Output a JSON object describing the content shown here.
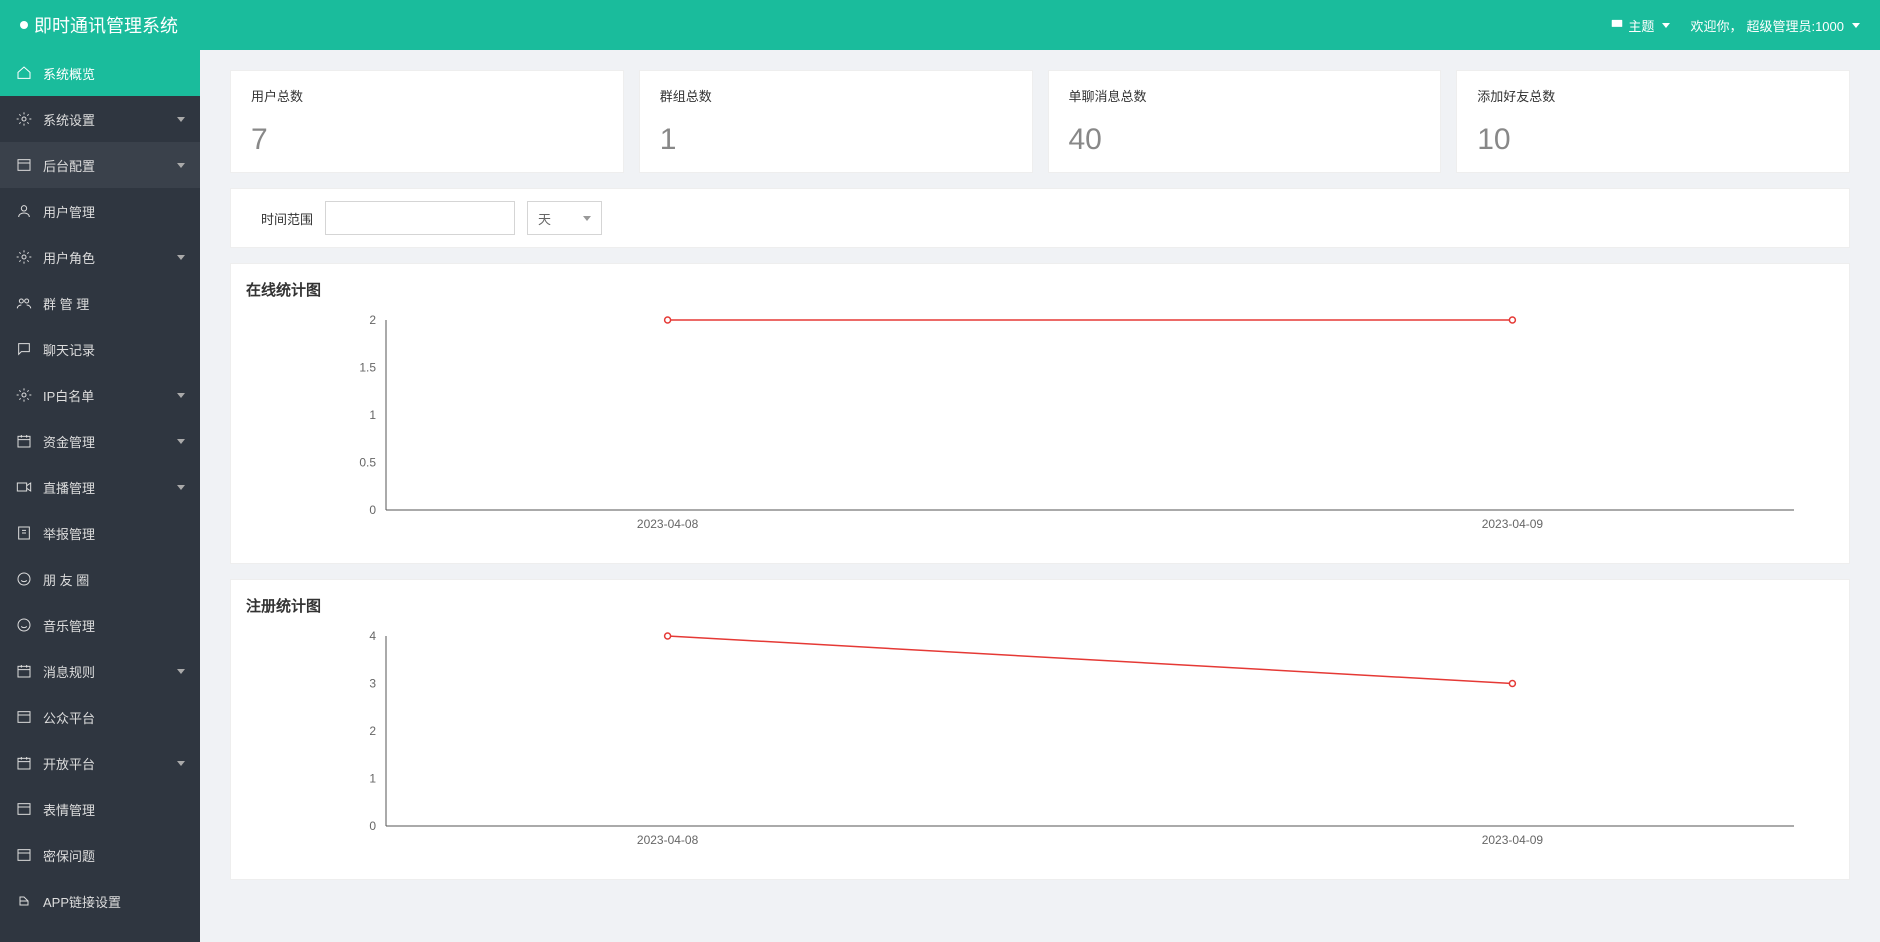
{
  "header": {
    "title": "即时通讯管理系统",
    "theme_label": "主题",
    "welcome_prefix": "欢迎你，",
    "user_label": "超级管理员:1000"
  },
  "sidebar": {
    "items": [
      {
        "label": "系统概览",
        "icon": "home",
        "arrow": false,
        "state": "active"
      },
      {
        "label": "系统设置",
        "icon": "gear",
        "arrow": true,
        "state": ""
      },
      {
        "label": "后台配置",
        "icon": "panel",
        "arrow": true,
        "state": "sub-active"
      },
      {
        "label": "用户管理",
        "icon": "user",
        "arrow": false,
        "state": ""
      },
      {
        "label": "用户角色",
        "icon": "gear",
        "arrow": true,
        "state": ""
      },
      {
        "label": "群 管 理",
        "icon": "group",
        "arrow": false,
        "state": ""
      },
      {
        "label": "聊天记录",
        "icon": "chat",
        "arrow": false,
        "state": ""
      },
      {
        "label": "IP白名单",
        "icon": "gear",
        "arrow": true,
        "state": ""
      },
      {
        "label": "资金管理",
        "icon": "calendar",
        "arrow": true,
        "state": ""
      },
      {
        "label": "直播管理",
        "icon": "video",
        "arrow": true,
        "state": ""
      },
      {
        "label": "举报管理",
        "icon": "report",
        "arrow": false,
        "state": ""
      },
      {
        "label": "朋 友 圈",
        "icon": "smile",
        "arrow": false,
        "state": ""
      },
      {
        "label": "音乐管理",
        "icon": "smile",
        "arrow": false,
        "state": ""
      },
      {
        "label": "消息规则",
        "icon": "calendar",
        "arrow": true,
        "state": ""
      },
      {
        "label": "公众平台",
        "icon": "panel",
        "arrow": false,
        "state": ""
      },
      {
        "label": "开放平台",
        "icon": "calendar",
        "arrow": true,
        "state": ""
      },
      {
        "label": "表情管理",
        "icon": "panel",
        "arrow": false,
        "state": ""
      },
      {
        "label": "密保问题",
        "icon": "panel",
        "arrow": false,
        "state": ""
      },
      {
        "label": "APP链接设置",
        "icon": "link",
        "arrow": false,
        "state": ""
      }
    ]
  },
  "stats": [
    {
      "label": "用户总数",
      "value": "7"
    },
    {
      "label": "群组总数",
      "value": "1"
    },
    {
      "label": "单聊消息总数",
      "value": "40"
    },
    {
      "label": "添加好友总数",
      "value": "10"
    }
  ],
  "filter": {
    "label": "时间范围",
    "input_value": "",
    "select_value": "天"
  },
  "chart1": {
    "title": "在线统计图"
  },
  "chart2": {
    "title": "注册统计图"
  },
  "chart_data": [
    {
      "type": "line",
      "title": "在线统计图",
      "categories": [
        "2023-04-08",
        "2023-04-09"
      ],
      "values": [
        2,
        2
      ],
      "ylim": [
        0,
        2
      ],
      "yticks": [
        0,
        0.5,
        1,
        1.5,
        2
      ]
    },
    {
      "type": "line",
      "title": "注册统计图",
      "categories": [
        "2023-04-08",
        "2023-04-09"
      ],
      "values": [
        4,
        3
      ],
      "ylim": [
        0,
        4
      ],
      "yticks": [
        0,
        1,
        2,
        3,
        4
      ]
    }
  ]
}
